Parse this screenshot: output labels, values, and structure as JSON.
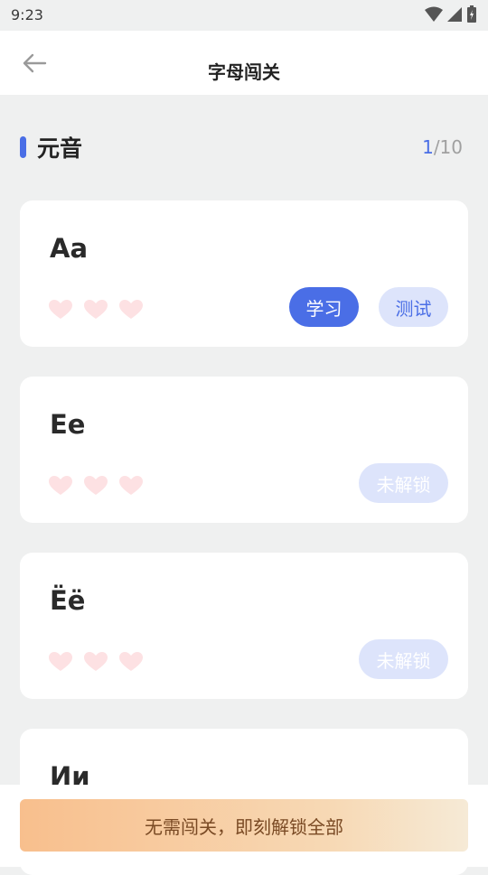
{
  "status_bar": {
    "time": "9:23"
  },
  "header": {
    "title": "字母闯关"
  },
  "section": {
    "title": "元音",
    "progress_current": "1",
    "progress_total": "/10"
  },
  "cards": [
    {
      "letter": "Aa",
      "hearts_filled": 0,
      "hearts_total": 3,
      "study_label": "学习",
      "test_label": "测试"
    },
    {
      "letter": "Ee",
      "hearts_filled": 0,
      "hearts_total": 3,
      "locked_label": "未解锁"
    },
    {
      "letter": "Ёё",
      "hearts_filled": 0,
      "hearts_total": 3,
      "locked_label": "未解锁"
    },
    {
      "letter": "Ии"
    }
  ],
  "bottom": {
    "unlock_label": "无需闯关，即刻解锁全部"
  },
  "colors": {
    "accent": "#4a6ee6",
    "heart_empty": "#fde1e3",
    "button_light": "#dde4fb"
  }
}
